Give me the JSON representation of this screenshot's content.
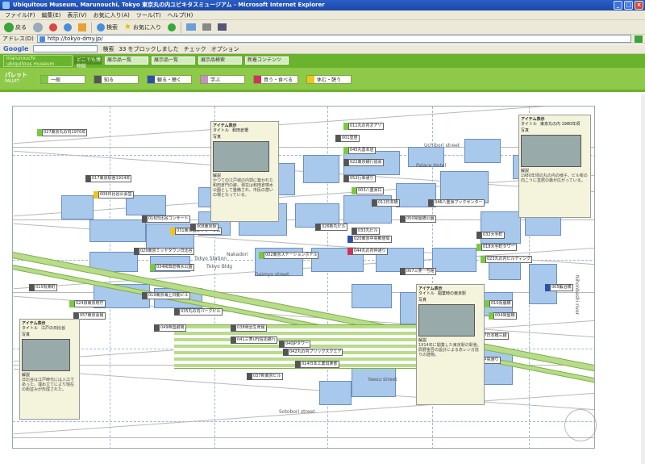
{
  "window": {
    "title": "Ubiquitous Museum, Marunouchi, Tokyo  東京丸の内ユビキタスミュージアム - Microsoft Internet Explorer"
  },
  "menu": [
    "ファイル(F)",
    "編集(E)",
    "表示(V)",
    "お気に入り(A)",
    "ツール(T)",
    "ヘルプ(H)"
  ],
  "toolbar": {
    "back": "戻る",
    "search": "検索",
    "favorites": "お気に入り"
  },
  "address": {
    "label": "アドレス(D)",
    "url": "http://tokyo-dmy.jp/"
  },
  "google": {
    "label": "Google",
    "search": "検索",
    "blocked": "33 をブロックしました",
    "check": "チェック",
    "options": "オプション"
  },
  "app": {
    "brand_top": "marunouchi",
    "brand": "ubiquitous museum",
    "nav": [
      "展示品一覧",
      "展示品一覧",
      "展示品検索",
      "新着コンテンツ"
    ],
    "nav_extra": "どこでも博物館"
  },
  "palette": {
    "label": "パレット",
    "sublabel": "PALLET",
    "items": [
      {
        "label": "一般",
        "color": "#7ac943"
      },
      {
        "label": "知る",
        "color": "#555555"
      },
      {
        "label": "観る・聴く",
        "color": "#2c4fa8"
      },
      {
        "label": "学ぶ",
        "color": "#c98fc4"
      },
      {
        "label": "買う・食べる",
        "color": "#d1315a"
      },
      {
        "label": "休む・憩う",
        "color": "#f0c419"
      }
    ]
  },
  "map_labels": [
    "Uchibori street",
    "Nihonbashi river",
    "Daimyo street",
    "Sotobori street",
    "Yaesu street",
    "Nakadori",
    "Palace Hotel",
    "Tokyo Station",
    "Tokyo Bldg"
  ],
  "pins": [
    {
      "label": "027東京丸の内1970年",
      "color": "#7ac943"
    },
    {
      "label": "017東京駅舎1914年",
      "color": "#555555"
    },
    {
      "label": "009日比谷公会堂",
      "color": "#f0c419"
    },
    {
      "label": "016日比谷コンサート",
      "color": "#555555"
    },
    {
      "label": "031東京国際フォーラム",
      "color": "#f0c419"
    },
    {
      "label": "029東京ミッドタウン日比谷",
      "color": "#555555"
    },
    {
      "label": "008東京駅",
      "color": "#555555"
    },
    {
      "label": "034和田倉噴水公園",
      "color": "#7ac943"
    },
    {
      "label": "019東京海上日動ビル",
      "color": "#555555"
    },
    {
      "label": "035丸の内パークビル",
      "color": "#555555"
    },
    {
      "label": "002東京ステーションホテル",
      "color": "#7ac943"
    },
    {
      "label": "026新丸ビル",
      "color": "#555555"
    },
    {
      "label": "033丸ビル",
      "color": "#555555"
    },
    {
      "label": "007三菱一号館",
      "color": "#555555"
    },
    {
      "label": "001皇居",
      "color": "#555555"
    },
    {
      "label": "011丸の内オアゾ",
      "color": "#7ac943"
    },
    {
      "label": "045丸善本店",
      "color": "#7ac943"
    },
    {
      "label": "022東京銀行協会",
      "color": "#555555"
    },
    {
      "label": "052行幸通り",
      "color": "#555555"
    },
    {
      "label": "003八重洲口",
      "color": "#7ac943"
    },
    {
      "label": "012日本橋",
      "color": "#555555"
    },
    {
      "label": "050常盤橋公園",
      "color": "#555555"
    },
    {
      "label": "020東京中央郵便局",
      "color": "#2c4fa8"
    },
    {
      "label": "044丸の内仲通り",
      "color": "#d1315a"
    },
    {
      "label": "015有楽町",
      "color": "#555555"
    },
    {
      "label": "024旧東京府庁",
      "color": "#7ac943"
    },
    {
      "label": "057東京会館",
      "color": "#555555"
    },
    {
      "label": "049帝国劇場",
      "color": "#555555"
    },
    {
      "label": "038明治生命館",
      "color": "#555555"
    },
    {
      "label": "041三菱UFJ信託銀行",
      "color": "#555555"
    },
    {
      "label": "040JPタワー",
      "color": "#555555"
    },
    {
      "label": "042丸の内ブリックスクエア",
      "color": "#555555"
    },
    {
      "label": "014日本工業倶楽部",
      "color": "#555555"
    },
    {
      "label": "037新東京ビル",
      "color": "#555555"
    },
    {
      "label": "032大手町",
      "color": "#555555"
    },
    {
      "label": "018大手町タワー",
      "color": "#7ac943"
    },
    {
      "label": "023丸の内ビルディング",
      "color": "#7ac943"
    },
    {
      "label": "005鍛冶橋",
      "color": "#2c4fa8"
    },
    {
      "label": "010呉服橋",
      "color": "#7ac943"
    },
    {
      "label": "004常盤橋",
      "color": "#7ac943"
    },
    {
      "label": "046八重洲ブックセンター",
      "color": "#555555"
    },
    {
      "label": "047日本橋三越",
      "color": "#7ac943"
    },
    {
      "label": "021中央通り",
      "color": "#7ac943"
    }
  ],
  "popups": [
    {
      "head": "アイテム表示",
      "title_label": "タイトル",
      "title": "和田倉橋",
      "photo_label": "写真",
      "desc_label": "解説",
      "text": "かつての江戸城の内郭に築かれた和田倉門の跡。現在は和田倉噴水公園として整備され、市民の憩いの場となっている。"
    },
    {
      "head": "アイテム表示",
      "title_label": "タイトル",
      "title": "東京丸の内 1980年頃",
      "photo_label": "写真",
      "desc_label": "解説",
      "text": "1980年頃の丸の内の様子。ビル街の向こうに皇居の森が広がっている。"
    },
    {
      "head": "アイテム表示",
      "title_label": "タイトル",
      "title": "開業時の東京駅",
      "photo_label": "写真",
      "desc_label": "解説",
      "text": "1914年に開業した東京駅の駅舎。辰野金吾の設計による赤レンガ造りの建物。"
    },
    {
      "head": "アイテム表示",
      "title_label": "タイトル",
      "title": "江戸の日比谷",
      "photo_label": "写真",
      "desc_label": "解説",
      "text": "日比谷は江戸時代には入江であった。埋め立てにより現在の街並みが形成された。"
    }
  ]
}
